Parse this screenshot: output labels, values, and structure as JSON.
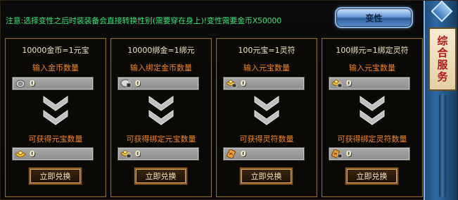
{
  "notice": "注意:选择变性之后时装装备会直接转换性别(需要穿在身上)!变性需要金币X50000",
  "gender_button": "变性",
  "side_panel": {
    "label": "综合服务"
  },
  "cards": [
    {
      "title": "10000金币=1元宝",
      "input_label": "输入金币数量",
      "input_value": "0",
      "input_icon": "silver-coin-icon",
      "output_label": "可获得元宝数量",
      "output_value": "0",
      "output_icon": "gold-ingot-icon",
      "button": "立即兑换"
    },
    {
      "title": "10000绑金=1绑元",
      "input_label": "输入绑定金币数量",
      "input_value": "0",
      "input_icon": "bound-coin-icon",
      "output_label": "可获得绑定元宝数量",
      "output_value": "0",
      "output_icon": "bound-ingot-icon",
      "button": "立即兑换"
    },
    {
      "title": "100元宝=1灵符",
      "input_label": "输入元宝数量",
      "input_value": "0",
      "input_icon": "gold-ingot-icon",
      "output_label": "可获得灵符数量",
      "output_value": "0",
      "output_icon": "talisman-icon",
      "button": "立即兑换"
    },
    {
      "title": "100绑元=1绑定灵符",
      "input_label": "输入元宝数量",
      "input_value": "0",
      "input_icon": "bound-ingot-icon",
      "output_label": "可获得绑定灵符数量",
      "output_value": "0",
      "output_icon": "bound-talisman-icon",
      "button": "立即兑换"
    }
  ],
  "colors": {
    "notice": "#3ee07a",
    "label": "#f2862a",
    "border": "#8a6a32",
    "side_panel": "#2f6aa4"
  }
}
